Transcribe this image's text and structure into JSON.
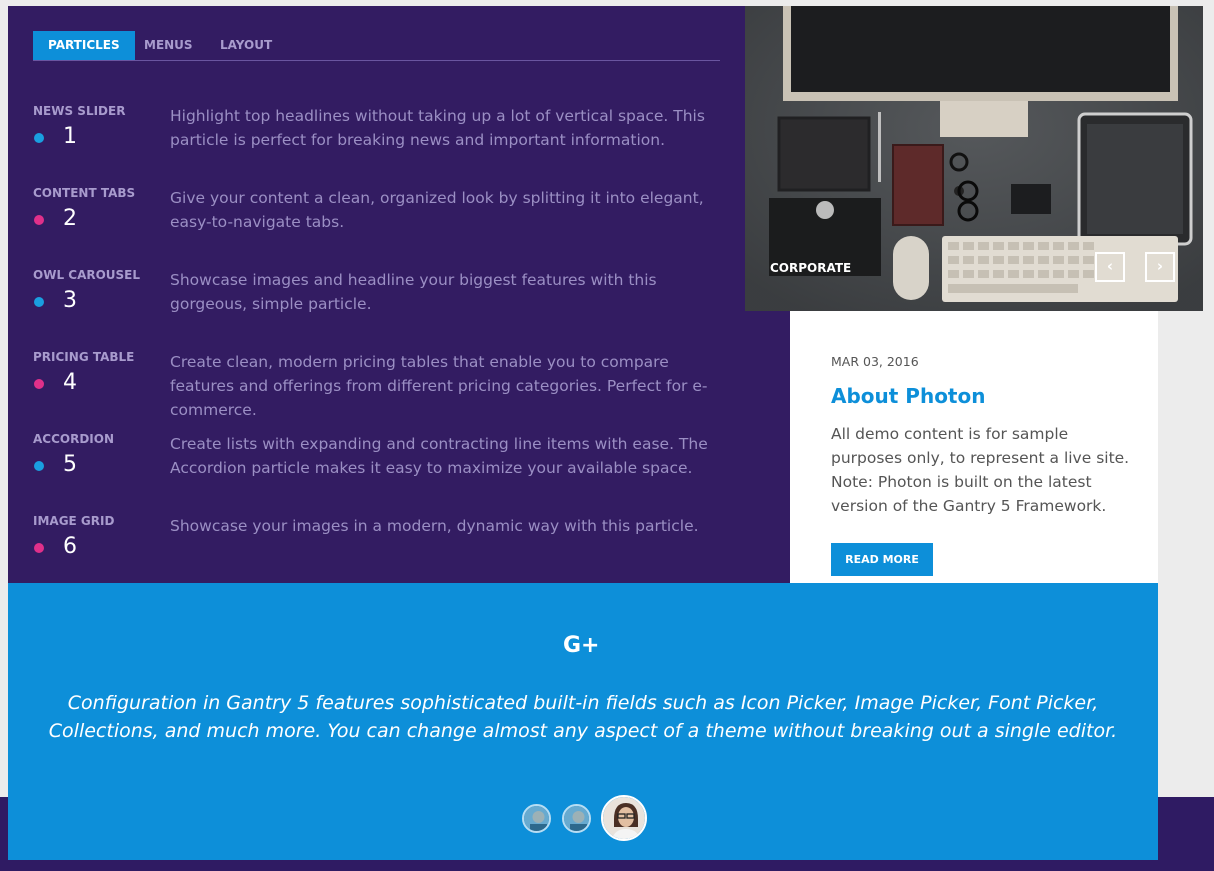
{
  "tabs": [
    {
      "label": "PARTICLES"
    },
    {
      "label": "MENUS"
    },
    {
      "label": "LAYOUT"
    }
  ],
  "particles": [
    {
      "title": "NEWS SLIDER",
      "number": "1",
      "dot_color": "#1a9fe0",
      "desc": "Highlight top headlines without taking up a lot of vertical space. This particle is perfect for breaking news and important information."
    },
    {
      "title": "CONTENT TABS",
      "number": "2",
      "dot_color": "#e0308a",
      "desc": "Give your content a clean, organized look by splitting it into elegant, easy-to-navigate tabs."
    },
    {
      "title": "OWL CAROUSEL",
      "number": "3",
      "dot_color": "#1a9fe0",
      "desc": "Showcase images and headline your biggest features with this gorgeous, simple particle."
    },
    {
      "title": "PRICING TABLE",
      "number": "4",
      "dot_color": "#e0308a",
      "desc": "Create clean, modern pricing tables that enable you to compare features and offerings from different pricing categories. Perfect for e-commerce."
    },
    {
      "title": "ACCORDION",
      "number": "5",
      "dot_color": "#1a9fe0",
      "desc": "Create lists with expanding and contracting line items with ease. The Accordion particle makes it easy to maximize your available space."
    },
    {
      "title": "IMAGE GRID",
      "number": "6",
      "dot_color": "#e0308a",
      "desc": "Showcase your images in a modern, dynamic way with this particle."
    }
  ],
  "feature": {
    "category": "CORPORATE",
    "prev_icon": "‹",
    "next_icon": "›"
  },
  "card": {
    "date": "MAR 03, 2016",
    "title": "About Photon",
    "body": "All demo content is for sample purposes only, to represent a live site. Note: Photon is built on the latest version of the Gantry 5 Framework.",
    "button": "READ MORE"
  },
  "testimonial": {
    "icon": "G+",
    "quote": "Configuration in Gantry 5 features sophisticated built-in fields such as Icon Picker, Image Picker, Font Picker, Collections, and much more. You can change almost any aspect of a theme without breaking out a single editor."
  },
  "colors": {
    "accent": "#0d8fd9",
    "panel_purple": "#331c62",
    "dot_blue": "#1a9fe0",
    "dot_pink": "#e0308a"
  }
}
